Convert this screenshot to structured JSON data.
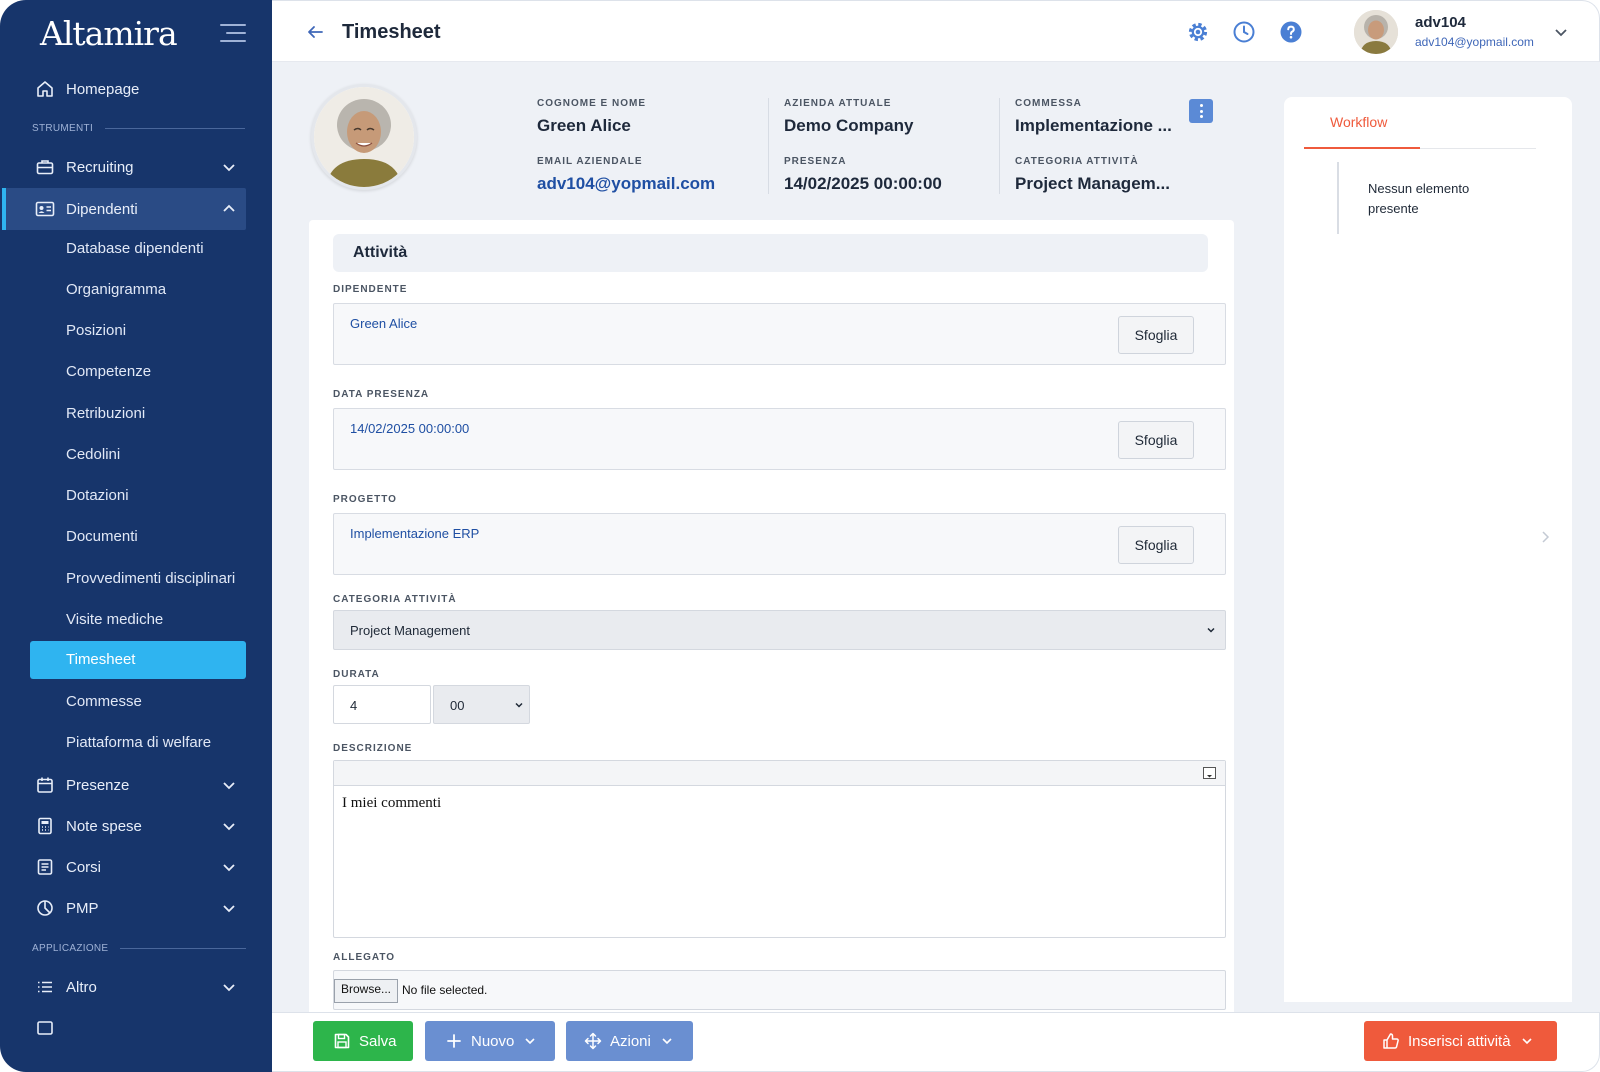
{
  "sidebar": {
    "logo": "Altamira",
    "items": [
      {
        "label": "Homepage"
      },
      {
        "label": "Recruiting"
      },
      {
        "label": "Dipendenti"
      },
      {
        "label": "Presenze"
      },
      {
        "label": "Note spese"
      },
      {
        "label": "Corsi"
      },
      {
        "label": "PMP"
      },
      {
        "label": "Altro"
      }
    ],
    "sections": {
      "tools": "STRUMENTI",
      "app": "APPLICAZIONE"
    },
    "subitems": [
      "Database dipendenti",
      "Organigramma",
      "Posizioni",
      "Competenze",
      "Retribuzioni",
      "Cedolini",
      "Dotazioni",
      "Documenti",
      "Provvedimenti disciplinari",
      "Visite mediche",
      "Timesheet",
      "Commesse",
      "Piattaforma di welfare"
    ]
  },
  "header": {
    "title": "Timesheet",
    "user_name": "adv104",
    "user_email": "adv104@yopmail.com"
  },
  "profile": {
    "name_label": "COGNOME E NOME",
    "name_value": "Green Alice",
    "email_label": "EMAIL AZIENDALE",
    "email_value": "adv104@yopmail.com",
    "company_label": "AZIENDA ATTUALE",
    "company_value": "Demo Company",
    "presence_label": "PRESENZA",
    "presence_value": "14/02/2025 00:00:00",
    "order_label": "COMMESSA",
    "order_value": "Implementazione ...",
    "category_label": "CATEGORIA ATTIVITÀ",
    "category_value": "Project Managem..."
  },
  "form": {
    "section_title": "Attività",
    "employee_label": "DIPENDENTE",
    "employee_value": "Green Alice",
    "date_label": "DATA PRESENZA",
    "date_value": "14/02/2025 00:00:00",
    "project_label": "PROGETTO",
    "project_value": "Implementazione ERP",
    "browse_label": "Sfoglia",
    "category_label": "CATEGORIA ATTIVITÀ",
    "category_value": "Project Management",
    "duration_label": "DURATA",
    "duration_hours": "4",
    "duration_minutes": "00",
    "description_label": "DESCRIZIONE",
    "description_value": "I miei commenti",
    "attachment_label": "ALLEGATO",
    "file_button": "Browse...",
    "file_status": "No file selected."
  },
  "workflow": {
    "tab": "Workflow",
    "empty": "Nessun elemento presente"
  },
  "footer": {
    "save": "Salva",
    "new": "Nuovo",
    "actions": "Azioni",
    "insert": "Inserisci attività"
  },
  "colors": {
    "sidebar": "#17356b",
    "accent": "#2fb4f0",
    "save": "#2db54b",
    "secondary": "#6a8fd1",
    "insert": "#ef5a3c"
  }
}
